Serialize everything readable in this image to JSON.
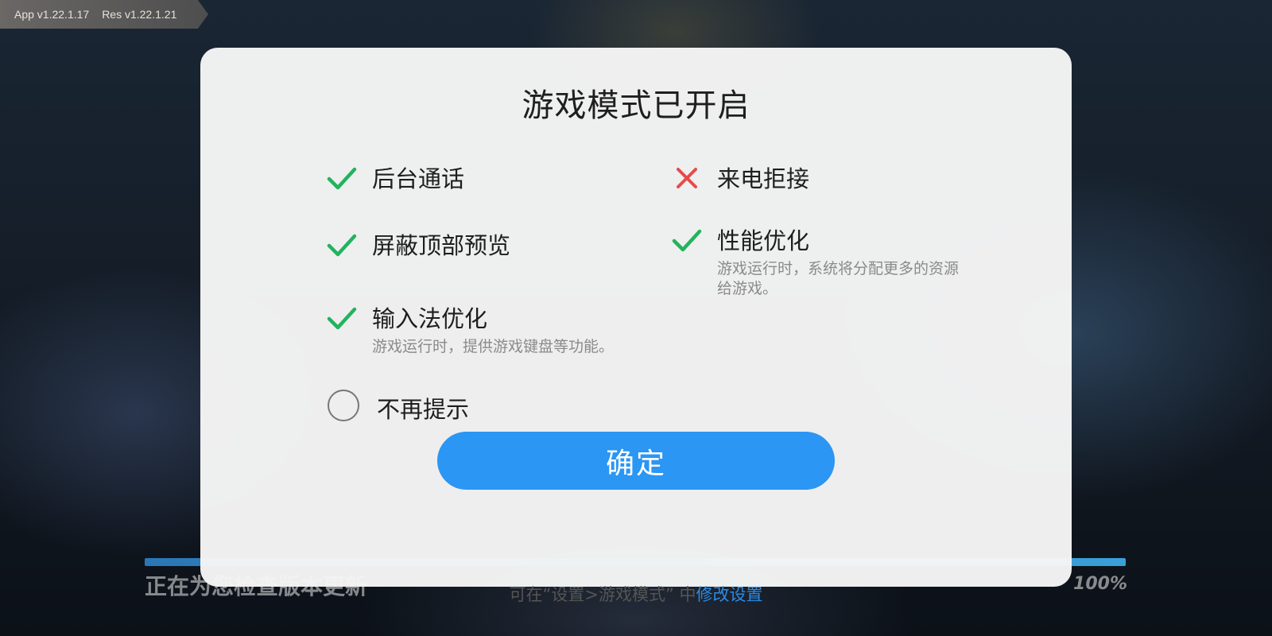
{
  "background": {
    "version_app": "App v1.22.1.17",
    "version_res": "Res v1.22.1.21",
    "status_text": "正在为您检查版本更新",
    "progress_percent_label": "100%",
    "progress_value": 1.0
  },
  "dialog": {
    "title": "游戏模式已开启",
    "features": [
      {
        "label": "后台通话",
        "status": "enabled",
        "icon": "check-icon"
      },
      {
        "label": "来电拒接",
        "status": "disabled",
        "icon": "cross-icon"
      },
      {
        "label": "屏蔽顶部预览",
        "status": "enabled",
        "icon": "check-icon"
      },
      {
        "label": "性能优化",
        "status": "enabled",
        "icon": "check-icon",
        "description": "游戏运行时，系统将分配更多的资源给游戏。"
      },
      {
        "label": "输入法优化",
        "status": "enabled",
        "icon": "check-icon",
        "description": "游戏运行时，提供游戏键盘等功能。"
      }
    ],
    "dont_show_again_label": "不再提示",
    "dont_show_again_checked": false,
    "confirm_label": "确定",
    "footer_prefix": "可在“设置>游戏模式” 中",
    "footer_link": "修改设置"
  },
  "colors": {
    "accent": "#2b96f3",
    "check": "#22b35e",
    "cross": "#e84a4a",
    "link": "#2b8be8"
  }
}
